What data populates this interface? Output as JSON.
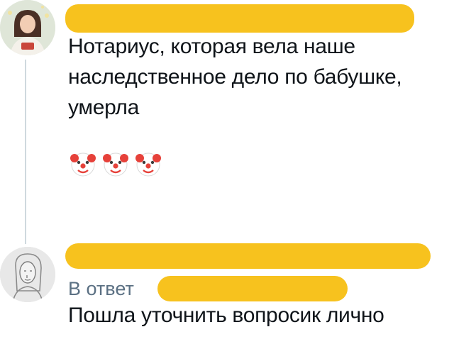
{
  "post": {
    "text_line_1": "Нотариус, которая вела наше",
    "text_line_2": "наследственное дело по бабушке,",
    "text_line_3": "умерла",
    "emojis": [
      "clown-face-icon",
      "clown-face-icon",
      "clown-face-icon"
    ]
  },
  "reply": {
    "prefix": "В ответ",
    "text": "Пошла уточнить вопросик лично"
  },
  "colors": {
    "redaction": "#f7c21e",
    "text": "#0f1419",
    "muted": "#5b7083",
    "thread_line": "#cfd9de"
  }
}
